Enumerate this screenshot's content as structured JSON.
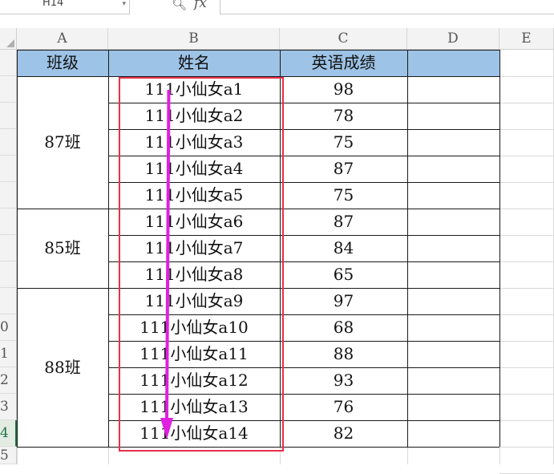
{
  "toolbar": {
    "name_box": "H14",
    "fx_label": "fx"
  },
  "columns": [
    "A",
    "B",
    "C",
    "D",
    "E"
  ],
  "row_numbers": [
    "",
    "",
    "",
    "",
    "",
    "",
    "",
    "",
    "",
    "0",
    "1",
    "2",
    "3",
    "4",
    "5"
  ],
  "active_row_index": 13,
  "headers": {
    "class": "班级",
    "name": "姓名",
    "score": "英语成绩"
  },
  "groups": [
    {
      "label": "87班",
      "rows": 5
    },
    {
      "label": "85班",
      "rows": 3
    },
    {
      "label": "88班",
      "rows": 6
    }
  ],
  "students": [
    {
      "name": "111小仙女a1",
      "score": "98"
    },
    {
      "name": "111小仙女a2",
      "score": "78"
    },
    {
      "name": "111小仙女a3",
      "score": "75"
    },
    {
      "name": "111小仙女a4",
      "score": "87"
    },
    {
      "name": "111小仙女a5",
      "score": "75"
    },
    {
      "name": "111小仙女a6",
      "score": "87"
    },
    {
      "name": "111小仙女a7",
      "score": "84"
    },
    {
      "name": "111小仙女a8",
      "score": "65"
    },
    {
      "name": "111小仙女a9",
      "score": "97"
    },
    {
      "name": "111小仙女a10",
      "score": "68"
    },
    {
      "name": "111小仙女a11",
      "score": "88"
    },
    {
      "name": "111小仙女a12",
      "score": "93"
    },
    {
      "name": "111小仙女a13",
      "score": "76"
    },
    {
      "name": "111小仙女a14",
      "score": "82"
    }
  ],
  "colors": {
    "header_fill": "#9dc3e6",
    "selection_box": "#e8304a",
    "arrow": "#e020e0"
  }
}
